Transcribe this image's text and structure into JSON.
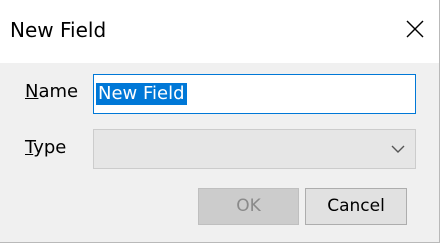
{
  "dialog": {
    "title": "New Field"
  },
  "form": {
    "name_label_accel": "N",
    "name_label_rest": "ame",
    "name_value": "New Field",
    "type_label_accel": "T",
    "type_label_rest": "ype",
    "type_value": ""
  },
  "buttons": {
    "ok_label": "OK",
    "cancel_label": "Cancel"
  },
  "colors": {
    "selection": "#0078d7",
    "dialog_body": "#f0f0f0",
    "disabled_button": "#cccccc"
  },
  "icons": {
    "close": "close-icon",
    "dropdown": "chevron-down-icon"
  }
}
